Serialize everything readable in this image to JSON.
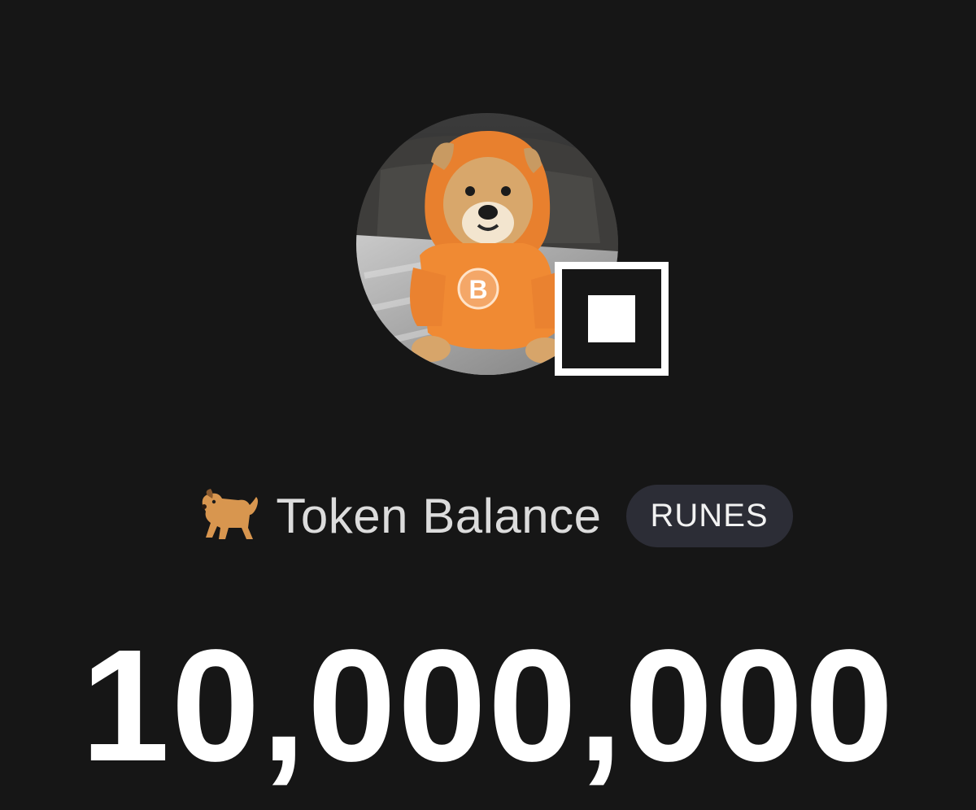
{
  "profile": {
    "avatar_icon": "shiba-dog-in-orange-bitcoin-hoodie",
    "badge_icon": "runes-square-icon"
  },
  "label": {
    "emoji_icon": "dog-icon",
    "text": "Token Balance",
    "tag": "RUNES"
  },
  "balance": {
    "value": "10,000,000"
  },
  "colors": {
    "background": "#161616",
    "pill_background": "#2c2d36",
    "hoodie_orange": "#f08a33",
    "text_primary": "#ffffff",
    "text_secondary": "#dcdcdc"
  }
}
